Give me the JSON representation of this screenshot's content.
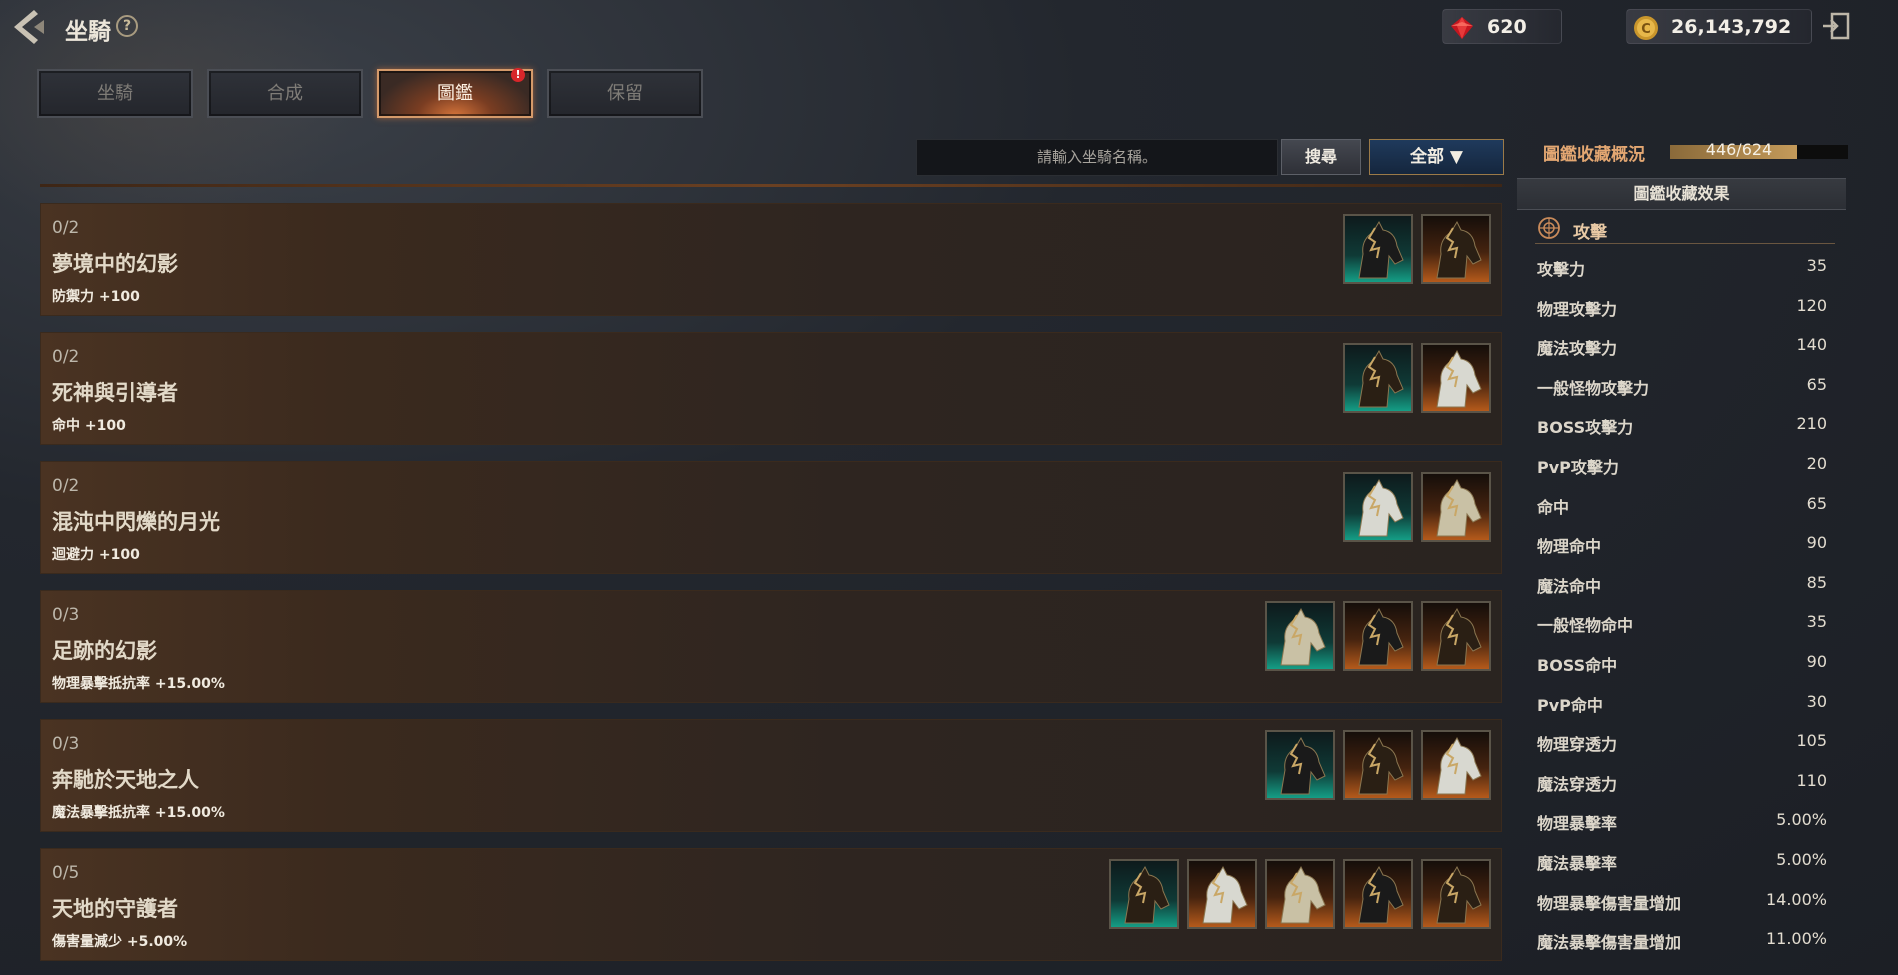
{
  "header": {
    "title": "坐騎",
    "help": "?",
    "gems": "620",
    "gold": "26,143,792"
  },
  "tabs": [
    {
      "label": "坐騎"
    },
    {
      "label": "合成"
    },
    {
      "label": "圖鑑",
      "badge": "!"
    },
    {
      "label": "保留"
    }
  ],
  "search": {
    "placeholder": "請輸入坐騎名稱。",
    "button": "搜尋",
    "filter": "全部 ▼"
  },
  "collections": [
    {
      "count": "0/2",
      "name": "夢境中的幻影",
      "bonus": "防禦力 +100",
      "mounts": [
        "teal",
        "orange"
      ]
    },
    {
      "count": "0/2",
      "name": "死神與引導者",
      "bonus": "命中 +100",
      "mounts": [
        "teal",
        "orange"
      ]
    },
    {
      "count": "0/2",
      "name": "混沌中閃爍的月光",
      "bonus": "迴避力 +100",
      "mounts": [
        "teal",
        "orange"
      ]
    },
    {
      "count": "0/3",
      "name": "足跡的幻影",
      "bonus": "物理暴擊抵抗率 +15.00%",
      "mounts": [
        "teal",
        "orange",
        "orange"
      ]
    },
    {
      "count": "0/3",
      "name": "奔馳於天地之人",
      "bonus": "魔法暴擊抵抗率 +15.00%",
      "mounts": [
        "teal",
        "orange",
        "orange"
      ]
    },
    {
      "count": "0/5",
      "name": "天地的守護者",
      "bonus": "傷害量減少 +5.00%",
      "mounts": [
        "teal",
        "orange",
        "orange",
        "orange",
        "orange"
      ]
    }
  ],
  "summary": {
    "label": "圖鑑收藏概況",
    "progress": "446/624",
    "progress_fraction": 0.715,
    "effect_title": "圖鑑收藏效果",
    "category": "攻擊"
  },
  "stats": [
    {
      "k": "攻擊力",
      "v": "35"
    },
    {
      "k": "物理攻擊力",
      "v": "120"
    },
    {
      "k": "魔法攻擊力",
      "v": "140"
    },
    {
      "k": "一般怪物攻擊力",
      "v": "65"
    },
    {
      "k": "BOSS攻擊力",
      "v": "210"
    },
    {
      "k": "PvP攻擊力",
      "v": "20"
    },
    {
      "k": "命中",
      "v": "65"
    },
    {
      "k": "物理命中",
      "v": "90"
    },
    {
      "k": "魔法命中",
      "v": "85"
    },
    {
      "k": "一般怪物命中",
      "v": "35"
    },
    {
      "k": "BOSS命中",
      "v": "90"
    },
    {
      "k": "PvP命中",
      "v": "30"
    },
    {
      "k": "物理穿透力",
      "v": "105"
    },
    {
      "k": "魔法穿透力",
      "v": "110"
    },
    {
      "k": "物理暴擊率",
      "v": "5.00%"
    },
    {
      "k": "魔法暴擊率",
      "v": "5.00%"
    },
    {
      "k": "物理暴擊傷害量增加",
      "v": "14.00%"
    },
    {
      "k": "魔法暴擊傷害量增加",
      "v": "11.00%"
    }
  ],
  "colors": {
    "accent": "#e3a772",
    "row_bg": "#3b2a1e",
    "tab_active": "#d59a6a"
  }
}
